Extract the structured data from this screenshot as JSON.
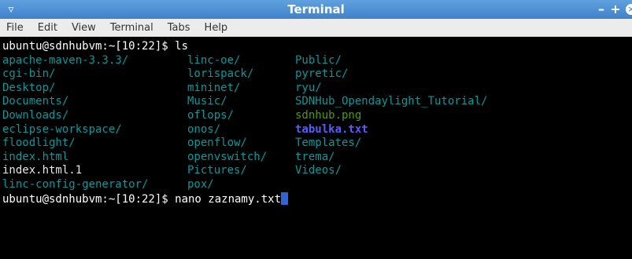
{
  "window": {
    "title": "Terminal",
    "menu_icon": "▿",
    "minimize": "–",
    "maximize": "+",
    "close": "×"
  },
  "menubar": [
    "File",
    "Edit",
    "View",
    "Terminal",
    "Tabs",
    "Help"
  ],
  "prompt1": "ubuntu@sdnhubvm:~[10:22]$ ls",
  "listing": [
    [
      {
        "t": "apache-maven-3.3.3/",
        "k": "dir"
      },
      {
        "t": "linc-oe/",
        "k": "dir"
      },
      {
        "t": "Public/",
        "k": "dir"
      }
    ],
    [
      {
        "t": "cgi-bin/",
        "k": "dir"
      },
      {
        "t": "lorispack/",
        "k": "dir"
      },
      {
        "t": "pyretic/",
        "k": "dir"
      }
    ],
    [
      {
        "t": "Desktop/",
        "k": "dir"
      },
      {
        "t": "mininet/",
        "k": "dir"
      },
      {
        "t": "ryu/",
        "k": "dir"
      }
    ],
    [
      {
        "t": "Documents/",
        "k": "dir"
      },
      {
        "t": "Music/",
        "k": "dir"
      },
      {
        "t": "SDNHub_Opendaylight_Tutorial/",
        "k": "dir"
      }
    ],
    [
      {
        "t": "Downloads/",
        "k": "dir"
      },
      {
        "t": "oflops/",
        "k": "dir"
      },
      {
        "t": "sdnhub.png",
        "k": "png"
      }
    ],
    [
      {
        "t": "eclipse-workspace/",
        "k": "dir"
      },
      {
        "t": "onos/",
        "k": "dir"
      },
      {
        "t": "tabulka.txt",
        "k": "bold-blue"
      }
    ],
    [
      {
        "t": "floodlight/",
        "k": "dir"
      },
      {
        "t": "openflow/",
        "k": "dir"
      },
      {
        "t": "Templates/",
        "k": "dir"
      }
    ],
    [
      {
        "t": "index.html",
        "k": "dir"
      },
      {
        "t": "openvswitch/",
        "k": "dir"
      },
      {
        "t": "trema/",
        "k": "dir"
      }
    ],
    [
      {
        "t": "index.html.1",
        "k": "file"
      },
      {
        "t": "Pictures/",
        "k": "dir"
      },
      {
        "t": "Videos/",
        "k": "dir"
      }
    ],
    [
      {
        "t": "linc-config-generator/",
        "k": "dir"
      },
      {
        "t": "pox/",
        "k": "dir"
      },
      {
        "t": "",
        "k": "dir"
      }
    ]
  ],
  "prompt2": "ubuntu@sdnhubvm:~[10:22]$ nano zaznamy.txt"
}
